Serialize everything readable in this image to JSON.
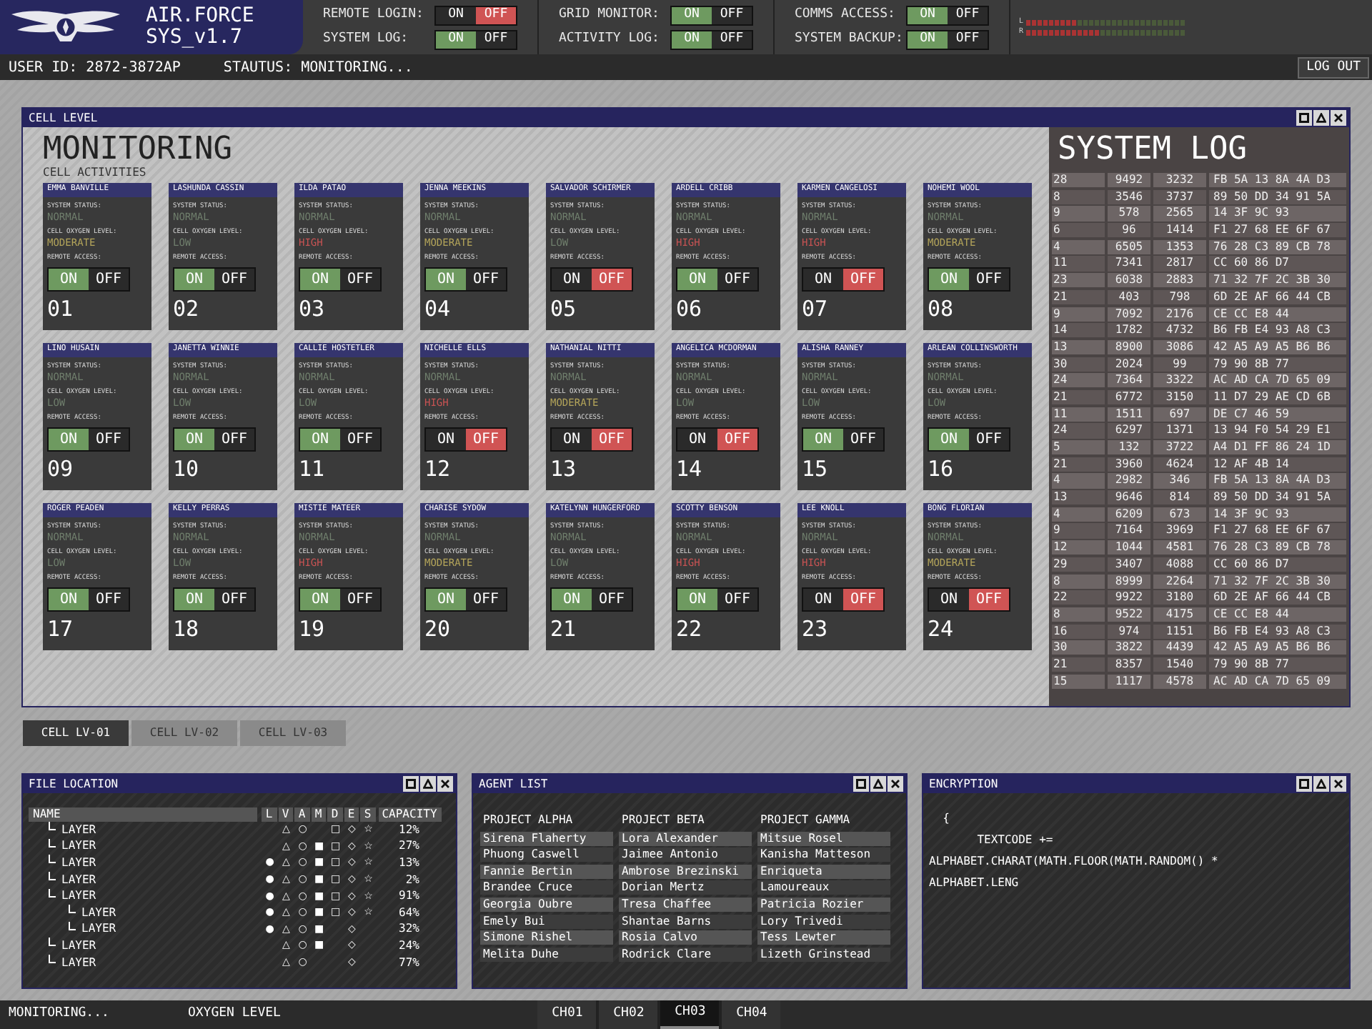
{
  "header": {
    "title": "AIR.FORCE",
    "subtitle": "SYS_v1.7",
    "toggles": [
      {
        "label": "REMOTE LOGIN:",
        "on_label": "ON",
        "off_label": "OFF",
        "on": false
      },
      {
        "label": "SYSTEM LOG:",
        "on_label": "ON",
        "off_label": "OFF",
        "on": true
      },
      {
        "label": "GRID MONITOR:",
        "on_label": "ON",
        "off_label": "OFF",
        "on": true
      },
      {
        "label": "ACTIVITY LOG:",
        "on_label": "ON",
        "off_label": "OFF",
        "on": true
      },
      {
        "label": "COMMS ACCESS:",
        "on_label": "ON",
        "off_label": "OFF",
        "on": true
      },
      {
        "label": "SYSTEM BACKUP:",
        "on_label": "ON",
        "off_label": "OFF",
        "on": true
      }
    ],
    "meter_labels": [
      "L",
      "R"
    ]
  },
  "user_bar": {
    "user_id": "USER ID: 2872-3872AP",
    "status": "STAUTUS: MONITORING...",
    "logout": "LOG OUT"
  },
  "cell_panel": {
    "title": "CELL LEVEL",
    "heading": "MONITORING",
    "subheading": "CELL ACTIVITIES",
    "cells": [
      {
        "name": "EMMA BANVILLE",
        "status_label": "SYSTEM STATUS:",
        "status": "NORMAL",
        "oxygen_label": "CELL OXYGEN LEVEL:",
        "oxygen": {
          "text": "MODERATE",
          "color": "#b3a45a"
        },
        "remote_label": "REMOTE ACCESS:",
        "on_label": "ON",
        "off_label": "OFF",
        "remote_on": true,
        "number": "01"
      },
      {
        "name": "LASHUNDA CASSIN",
        "status_label": "SYSTEM STATUS:",
        "status": "NORMAL",
        "oxygen_label": "CELL OXYGEN LEVEL:",
        "oxygen": {
          "text": "LOW",
          "color": "#6f7e6c"
        },
        "remote_label": "REMOTE ACCESS:",
        "on_label": "ON",
        "off_label": "OFF",
        "remote_on": true,
        "number": "02"
      },
      {
        "name": "ILDA PATAO",
        "status_label": "SYSTEM STATUS:",
        "status": "NORMAL",
        "oxygen_label": "CELL OXYGEN LEVEL:",
        "oxygen": {
          "text": "HIGH",
          "color": "#c65353"
        },
        "remote_label": "REMOTE ACCESS:",
        "on_label": "ON",
        "off_label": "OFF",
        "remote_on": true,
        "number": "03"
      },
      {
        "name": "JENNA MEEKINS",
        "status_label": "SYSTEM STATUS:",
        "status": "NORMAL",
        "oxygen_label": "CELL OXYGEN LEVEL:",
        "oxygen": {
          "text": "MODERATE",
          "color": "#b3a45a"
        },
        "remote_label": "REMOTE ACCESS:",
        "on_label": "ON",
        "off_label": "OFF",
        "remote_on": true,
        "number": "04"
      },
      {
        "name": "SALVADOR SCHIRMER",
        "status_label": "SYSTEM STATUS:",
        "status": "NORMAL",
        "oxygen_label": "CELL OXYGEN LEVEL:",
        "oxygen": {
          "text": "LOW",
          "color": "#6f7e6c"
        },
        "remote_label": "REMOTE ACCESS:",
        "on_label": "ON",
        "off_label": "OFF",
        "remote_on": false,
        "number": "05"
      },
      {
        "name": "ARDELL CRIBB",
        "status_label": "SYSTEM STATUS:",
        "status": "NORMAL",
        "oxygen_label": "CELL OXYGEN LEVEL:",
        "oxygen": {
          "text": "HIGH",
          "color": "#c65353"
        },
        "remote_label": "REMOTE ACCESS:",
        "on_label": "ON",
        "off_label": "OFF",
        "remote_on": true,
        "number": "06"
      },
      {
        "name": "KARMEN CANGELOSI",
        "status_label": "SYSTEM STATUS:",
        "status": "NORMAL",
        "oxygen_label": "CELL OXYGEN LEVEL:",
        "oxygen": {
          "text": "HIGH",
          "color": "#c65353"
        },
        "remote_label": "REMOTE ACCESS:",
        "on_label": "ON",
        "off_label": "OFF",
        "remote_on": false,
        "number": "07"
      },
      {
        "name": "NOHEMI WOOL",
        "status_label": "SYSTEM STATUS:",
        "status": "NORMAL",
        "oxygen_label": "CELL OXYGEN LEVEL:",
        "oxygen": {
          "text": "MODERATE",
          "color": "#b3a45a"
        },
        "remote_label": "REMOTE ACCESS:",
        "on_label": "ON",
        "off_label": "OFF",
        "remote_on": true,
        "number": "08"
      },
      {
        "name": "LINO HUSAIN",
        "status_label": "SYSTEM STATUS:",
        "status": "NORMAL",
        "oxygen_label": "CELL OXYGEN LEVEL:",
        "oxygen": {
          "text": "LOW",
          "color": "#6f7e6c"
        },
        "remote_label": "REMOTE ACCESS:",
        "on_label": "ON",
        "off_label": "OFF",
        "remote_on": true,
        "number": "09"
      },
      {
        "name": "JANETTA WINNIE",
        "status_label": "SYSTEM STATUS:",
        "status": "NORMAL",
        "oxygen_label": "CELL OXYGEN LEVEL:",
        "oxygen": {
          "text": "LOW",
          "color": "#6f7e6c"
        },
        "remote_label": "REMOTE ACCESS:",
        "on_label": "ON",
        "off_label": "OFF",
        "remote_on": true,
        "number": "10"
      },
      {
        "name": "CALLIE HOSTETLER",
        "status_label": "SYSTEM STATUS:",
        "status": "NORMAL",
        "oxygen_label": "CELL OXYGEN LEVEL:",
        "oxygen": {
          "text": "LOW",
          "color": "#6f7e6c"
        },
        "remote_label": "REMOTE ACCESS:",
        "on_label": "ON",
        "off_label": "OFF",
        "remote_on": true,
        "number": "11"
      },
      {
        "name": "NICHELLE ELLS",
        "status_label": "SYSTEM STATUS:",
        "status": "NORMAL",
        "oxygen_label": "CELL OXYGEN LEVEL:",
        "oxygen": {
          "text": "HIGH",
          "color": "#c65353"
        },
        "remote_label": "REMOTE ACCESS:",
        "on_label": "ON",
        "off_label": "OFF",
        "remote_on": false,
        "number": "12"
      },
      {
        "name": "NATHANIAL NITTI",
        "status_label": "SYSTEM STATUS:",
        "status": "NORMAL",
        "oxygen_label": "CELL OXYGEN LEVEL:",
        "oxygen": {
          "text": "MODERATE",
          "color": "#b3a45a"
        },
        "remote_label": "REMOTE ACCESS:",
        "on_label": "ON",
        "off_label": "OFF",
        "remote_on": false,
        "number": "13"
      },
      {
        "name": "ANGELICA MCDORMAN",
        "status_label": "SYSTEM STATUS:",
        "status": "NORMAL",
        "oxygen_label": "CELL OXYGEN LEVEL:",
        "oxygen": {
          "text": "LOW",
          "color": "#6f7e6c"
        },
        "remote_label": "REMOTE ACCESS:",
        "on_label": "ON",
        "off_label": "OFF",
        "remote_on": false,
        "number": "14"
      },
      {
        "name": "ALISHA RANNEY",
        "status_label": "SYSTEM STATUS:",
        "status": "NORMAL",
        "oxygen_label": "CELL OXYGEN LEVEL:",
        "oxygen": {
          "text": "LOW",
          "color": "#6f7e6c"
        },
        "remote_label": "REMOTE ACCESS:",
        "on_label": "ON",
        "off_label": "OFF",
        "remote_on": true,
        "number": "15"
      },
      {
        "name": "ARLEAN COLLINSWORTH",
        "status_label": "SYSTEM STATUS:",
        "status": "NORMAL",
        "oxygen_label": "CELL OXYGEN LEVEL:",
        "oxygen": {
          "text": "LOW",
          "color": "#6f7e6c"
        },
        "remote_label": "REMOTE ACCESS:",
        "on_label": "ON",
        "off_label": "OFF",
        "remote_on": true,
        "number": "16"
      },
      {
        "name": "ROGER PEADEN",
        "status_label": "SYSTEM STATUS:",
        "status": "NORMAL",
        "oxygen_label": "CELL OXYGEN LEVEL:",
        "oxygen": {
          "text": "LOW",
          "color": "#6f7e6c"
        },
        "remote_label": "REMOTE ACCESS:",
        "on_label": "ON",
        "off_label": "OFF",
        "remote_on": true,
        "number": "17"
      },
      {
        "name": "KELLY PERRAS",
        "status_label": "SYSTEM STATUS:",
        "status": "NORMAL",
        "oxygen_label": "CELL OXYGEN LEVEL:",
        "oxygen": {
          "text": "LOW",
          "color": "#6f7e6c"
        },
        "remote_label": "REMOTE ACCESS:",
        "on_label": "ON",
        "off_label": "OFF",
        "remote_on": true,
        "number": "18"
      },
      {
        "name": "MISTIE MATEER",
        "status_label": "SYSTEM STATUS:",
        "status": "NORMAL",
        "oxygen_label": "CELL OXYGEN LEVEL:",
        "oxygen": {
          "text": "HIGH",
          "color": "#c65353"
        },
        "remote_label": "REMOTE ACCESS:",
        "on_label": "ON",
        "off_label": "OFF",
        "remote_on": true,
        "number": "19"
      },
      {
        "name": "CHARISE SYDOW",
        "status_label": "SYSTEM STATUS:",
        "status": "NORMAL",
        "oxygen_label": "CELL OXYGEN LEVEL:",
        "oxygen": {
          "text": "MODERATE",
          "color": "#b3a45a"
        },
        "remote_label": "REMOTE ACCESS:",
        "on_label": "ON",
        "off_label": "OFF",
        "remote_on": true,
        "number": "20"
      },
      {
        "name": "KATELYNN HUNGERFORD",
        "status_label": "SYSTEM STATUS:",
        "status": "NORMAL",
        "oxygen_label": "CELL OXYGEN LEVEL:",
        "oxygen": {
          "text": "LOW",
          "color": "#6f7e6c"
        },
        "remote_label": "REMOTE ACCESS:",
        "on_label": "ON",
        "off_label": "OFF",
        "remote_on": true,
        "number": "21"
      },
      {
        "name": "SCOTTY BENSON",
        "status_label": "SYSTEM STATUS:",
        "status": "NORMAL",
        "oxygen_label": "CELL OXYGEN LEVEL:",
        "oxygen": {
          "text": "HIGH",
          "color": "#c65353"
        },
        "remote_label": "REMOTE ACCESS:",
        "on_label": "ON",
        "off_label": "OFF",
        "remote_on": true,
        "number": "22"
      },
      {
        "name": "LEE KNOLL",
        "status_label": "SYSTEM STATUS:",
        "status": "NORMAL",
        "oxygen_label": "CELL OXYGEN LEVEL:",
        "oxygen": {
          "text": "HIGH",
          "color": "#c65353"
        },
        "remote_label": "REMOTE ACCESS:",
        "on_label": "ON",
        "off_label": "OFF",
        "remote_on": false,
        "number": "23"
      },
      {
        "name": "BONG FLORIAN",
        "status_label": "SYSTEM STATUS:",
        "status": "NORMAL",
        "oxygen_label": "CELL OXYGEN LEVEL:",
        "oxygen": {
          "text": "MODERATE",
          "color": "#b3a45a"
        },
        "remote_label": "REMOTE ACCESS:",
        "on_label": "ON",
        "off_label": "OFF",
        "remote_on": false,
        "number": "24"
      }
    ],
    "system_log": {
      "title": "SYSTEM LOG",
      "rows": [
        [
          "28",
          "9492",
          "3232",
          "FB 5A 13 8A 4A D3"
        ],
        [
          "8",
          "3546",
          "3737",
          "89 50 DD 34 91 5A"
        ],
        [
          "9",
          "578",
          "2565",
          "14 3F 9C 93"
        ],
        [
          "6",
          "96",
          "1414",
          "F1 27 68 EE 6F 67"
        ],
        [
          "4",
          "6505",
          "1353",
          "76 28 C3 89 CB 78"
        ],
        [
          "11",
          "7341",
          "2817",
          "CC 60 86 D7"
        ],
        [
          "23",
          "6038",
          "2883",
          "71 32 7F 2C 3B 30"
        ],
        [
          "21",
          "403",
          "798",
          "6D 2E AF 66 44 CB"
        ],
        [
          "9",
          "7092",
          "2176",
          "CE CC E8 44"
        ],
        [
          "14",
          "1782",
          "4732",
          "B6 FB E4 93 A8 C3"
        ],
        [
          "13",
          "8900",
          "3086",
          "42 A5 A9 A5 B6 B6"
        ],
        [
          "30",
          "2024",
          "99",
          "79 90 8B 77"
        ],
        [
          "24",
          "7364",
          "3322",
          "AC AD CA 7D 65 09"
        ],
        [
          "21",
          "6772",
          "3150",
          "11 D7 29 AE CD 6B"
        ],
        [
          "11",
          "1511",
          "697",
          "DE C7 46 59"
        ],
        [
          "24",
          "6297",
          "1371",
          "13 94 F0 54 29 E1"
        ],
        [
          "5",
          "132",
          "3722",
          "A4 D1 FF 86 24 1D"
        ],
        [
          "21",
          "3960",
          "4624",
          "12 AF 4B 14"
        ],
        [
          "4",
          "2982",
          "346",
          "FB 5A 13 8A 4A D3"
        ],
        [
          "13",
          "9646",
          "814",
          "89 50 DD 34 91 5A"
        ],
        [
          "4",
          "6209",
          "673",
          "14 3F 9C 93"
        ],
        [
          "9",
          "7164",
          "3969",
          "F1 27 68 EE 6F 67"
        ],
        [
          "12",
          "1044",
          "4581",
          "76 28 C3 89 CB 78"
        ],
        [
          "29",
          "3407",
          "4088",
          "CC 60 86 D7"
        ],
        [
          "8",
          "8999",
          "2264",
          "71 32 7F 2C 3B 30"
        ],
        [
          "22",
          "9922",
          "3180",
          "6D 2E AF 66 44 CB"
        ],
        [
          "8",
          "9522",
          "4175",
          "CE CC E8 44"
        ],
        [
          "16",
          "974",
          "1151",
          "B6 FB E4 93 A8 C3"
        ],
        [
          "30",
          "3822",
          "4439",
          "42 A5 A9 A5 B6 B6"
        ],
        [
          "21",
          "8357",
          "1540",
          "79 90 8B 77"
        ],
        [
          "15",
          "1117",
          "4578",
          "AC AD CA 7D 65 09"
        ]
      ]
    },
    "tabs": [
      {
        "label": "CELL LV-01",
        "selected": true
      },
      {
        "label": "CELL LV-02",
        "selected": false
      },
      {
        "label": "CELL LV-03",
        "selected": false
      }
    ]
  },
  "file_location": {
    "title": "FILE LOCATION",
    "columns": [
      "NAME",
      "L",
      "V",
      "A",
      "M",
      "D",
      "E",
      "S",
      "CAPACITY"
    ],
    "rows": [
      {
        "name": "LAYER",
        "marks": {
          "v": "△",
          "a": "○",
          "d": "□",
          "e": "◇",
          "s": "☆"
        },
        "capacity": "12%"
      },
      {
        "name": "LAYER",
        "marks": {
          "v": "△",
          "a": "○",
          "m": "■",
          "d": "□",
          "e": "◇",
          "s": "☆"
        },
        "capacity": "27%"
      },
      {
        "name": "LAYER",
        "marks": {
          "l": "●",
          "v": "△",
          "a": "○",
          "m": "■",
          "d": "□",
          "e": "◇",
          "s": "☆"
        },
        "capacity": "13%"
      },
      {
        "name": "LAYER",
        "marks": {
          "l": "●",
          "v": "△",
          "a": "○",
          "m": "■",
          "d": "□",
          "e": "◇",
          "s": "☆"
        },
        "capacity": "2%"
      },
      {
        "name": "LAYER",
        "marks": {
          "l": "●",
          "v": "△",
          "a": "○",
          "m": "■",
          "d": "□",
          "e": "◇",
          "s": "☆"
        },
        "capacity": "91%",
        "children": [
          {
            "name": "LAYER",
            "marks": {
              "l": "●",
              "v": "△",
              "a": "○",
              "m": "■",
              "d": "□",
              "e": "◇",
              "s": "☆"
            },
            "capacity": "64%"
          },
          {
            "name": "LAYER",
            "marks": {
              "l": "●",
              "v": "△",
              "a": "○",
              "m": "■",
              "e": "◇"
            },
            "capacity": "32%"
          }
        ]
      },
      {
        "name": "LAYER",
        "marks": {
          "v": "△",
          "a": "○",
          "m": "■",
          "e": "◇"
        },
        "capacity": "24%"
      },
      {
        "name": "LAYER",
        "marks": {
          "v": "△",
          "a": "○",
          "e": "◇"
        },
        "capacity": "77%"
      }
    ]
  },
  "agent_list": {
    "title": "AGENT LIST",
    "projects": [
      {
        "name": "PROJECT ALPHA",
        "agents": [
          "Sirena Flaherty",
          "Phuong Caswell",
          "Fannie Bertin",
          "Brandee Cruce",
          "Georgia Oubre",
          "Emely Bui",
          "Simone Rishel",
          "Melita Duhe"
        ]
      },
      {
        "name": "PROJECT BETA",
        "agents": [
          "Lora Alexander",
          "Jaimee Antonio",
          "Ambrose Brezinski",
          "Dorian Mertz",
          "Tresa Chaffee",
          "Shantae Barns",
          "Rosia Calvo",
          "Rodrick Clare"
        ]
      },
      {
        "name": "PROJECT GAMMA",
        "agents": [
          "Mitsue Rosel",
          "Kanisha Matteson",
          "Enriqueta",
          "Lamoureaux",
          "Patricia Rozier",
          "Lory Trivedi",
          "Tess Lewter",
          "Lizeth Grinstead"
        ]
      }
    ]
  },
  "encryption": {
    "title": "ENCRYPTION",
    "lines": [
      "  {",
      "       TEXTCODE +=",
      "ALPHABET.CHARAT(MATH.FLOOR(MATH.RANDOM() *",
      "ALPHABET.LENG"
    ]
  },
  "status_bar": {
    "left": "MONITORING...",
    "middle": "OXYGEN LEVEL",
    "channels": [
      {
        "label": "CH01",
        "selected": false
      },
      {
        "label": "CH02",
        "selected": false
      },
      {
        "label": "CH03",
        "selected": true
      },
      {
        "label": "CH04",
        "selected": false
      }
    ]
  }
}
